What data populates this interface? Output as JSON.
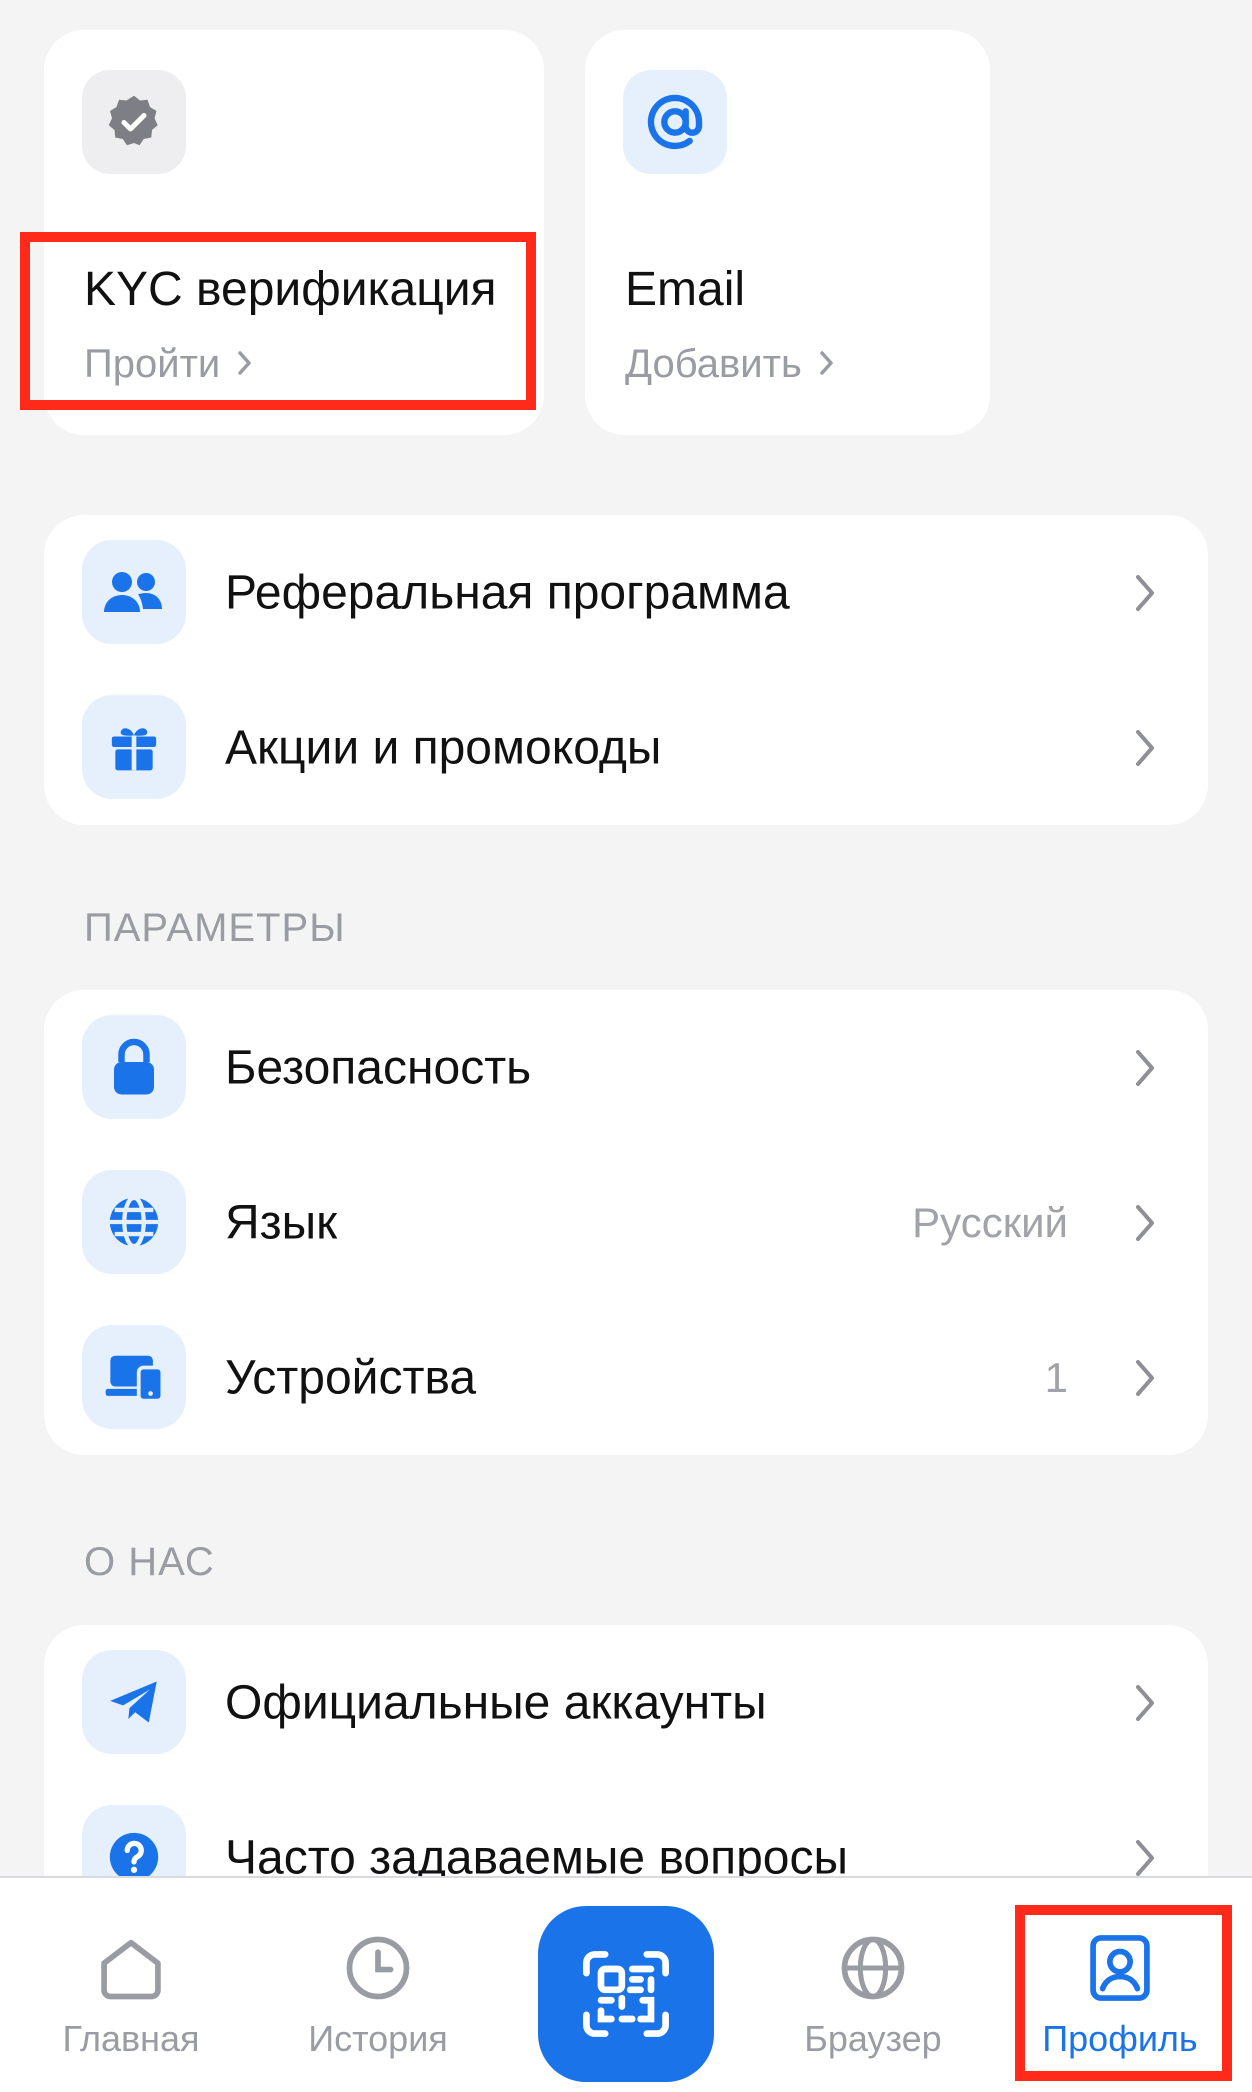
{
  "top_cards": {
    "kyc": {
      "title": "KYC верификация",
      "action": "Пройти",
      "icon": "verified-badge-icon"
    },
    "email": {
      "title": "Email",
      "action": "Добавить",
      "icon": "at-sign-icon"
    }
  },
  "group1": [
    {
      "label": "Реферальная программа",
      "icon": "users-icon"
    },
    {
      "label": "Акции и промокоды",
      "icon": "gift-icon"
    }
  ],
  "params": {
    "title": "ПАРАМЕТРЫ",
    "items": [
      {
        "label": "Безопасность",
        "icon": "lock-icon"
      },
      {
        "label": "Язык",
        "value": "Русский",
        "icon": "globe-icon"
      },
      {
        "label": "Устройства",
        "value": "1",
        "icon": "devices-icon"
      }
    ]
  },
  "about": {
    "title": "О НАС",
    "items": [
      {
        "label": "Официальные аккаунты",
        "icon": "telegram-icon"
      },
      {
        "label": "Часто задаваемые вопросы",
        "icon": "question-icon"
      }
    ]
  },
  "tabbar": {
    "items": [
      {
        "label": "Главная",
        "icon": "home-icon"
      },
      {
        "label": "История",
        "icon": "clock-icon"
      },
      {
        "label": "",
        "icon": "qr-scan-icon"
      },
      {
        "label": "Браузер",
        "icon": "globe-icon"
      },
      {
        "label": "Профиль",
        "icon": "profile-icon",
        "active": true
      }
    ]
  },
  "colors": {
    "accent": "#1a73e8",
    "highlight": "#ff2a1a",
    "background": "#f4f4f5",
    "muted": "#9a9ca3"
  }
}
